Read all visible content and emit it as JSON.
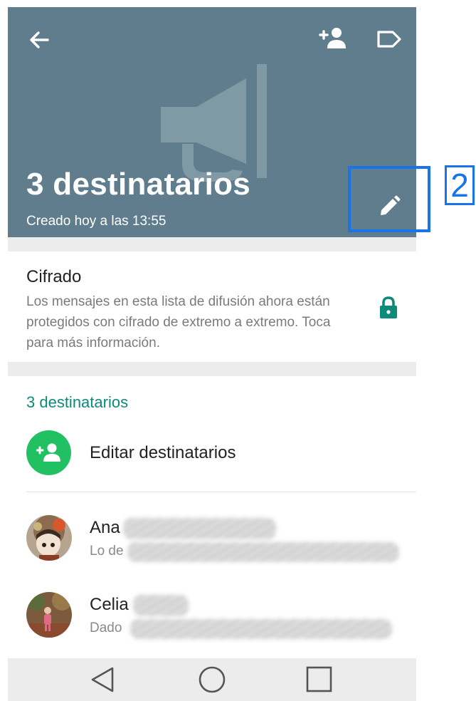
{
  "header": {
    "title": "3 destinatarios",
    "subtitle": "Creado hoy a las 13:55",
    "background_color": "#5f7d8c",
    "icons": [
      "back-arrow-icon",
      "add-person-icon",
      "label-icon",
      "megaphone-icon",
      "pencil-icon"
    ]
  },
  "encryption": {
    "title": "Cifrado",
    "description": "Los mensajes en esta lista de difusión ahora están protegidos con cifrado de extremo a extremo. Toca para más información.",
    "icon": "lock-icon",
    "icon_color": "#0e8a7b"
  },
  "recipients": {
    "header": "3 destinatarios",
    "header_color": "#0e8a7b",
    "edit_label": "Editar destinatarios",
    "edit_button_color": "#21c063",
    "contacts": [
      {
        "name": "Ana",
        "status": "Lo de"
      },
      {
        "name": "Celia",
        "status": "Dado"
      }
    ]
  },
  "navbar": {
    "buttons": [
      "back-triangle-icon",
      "home-circle-icon",
      "recents-square-icon"
    ]
  },
  "annotation": {
    "label": "2",
    "color": "#1a73e8"
  }
}
